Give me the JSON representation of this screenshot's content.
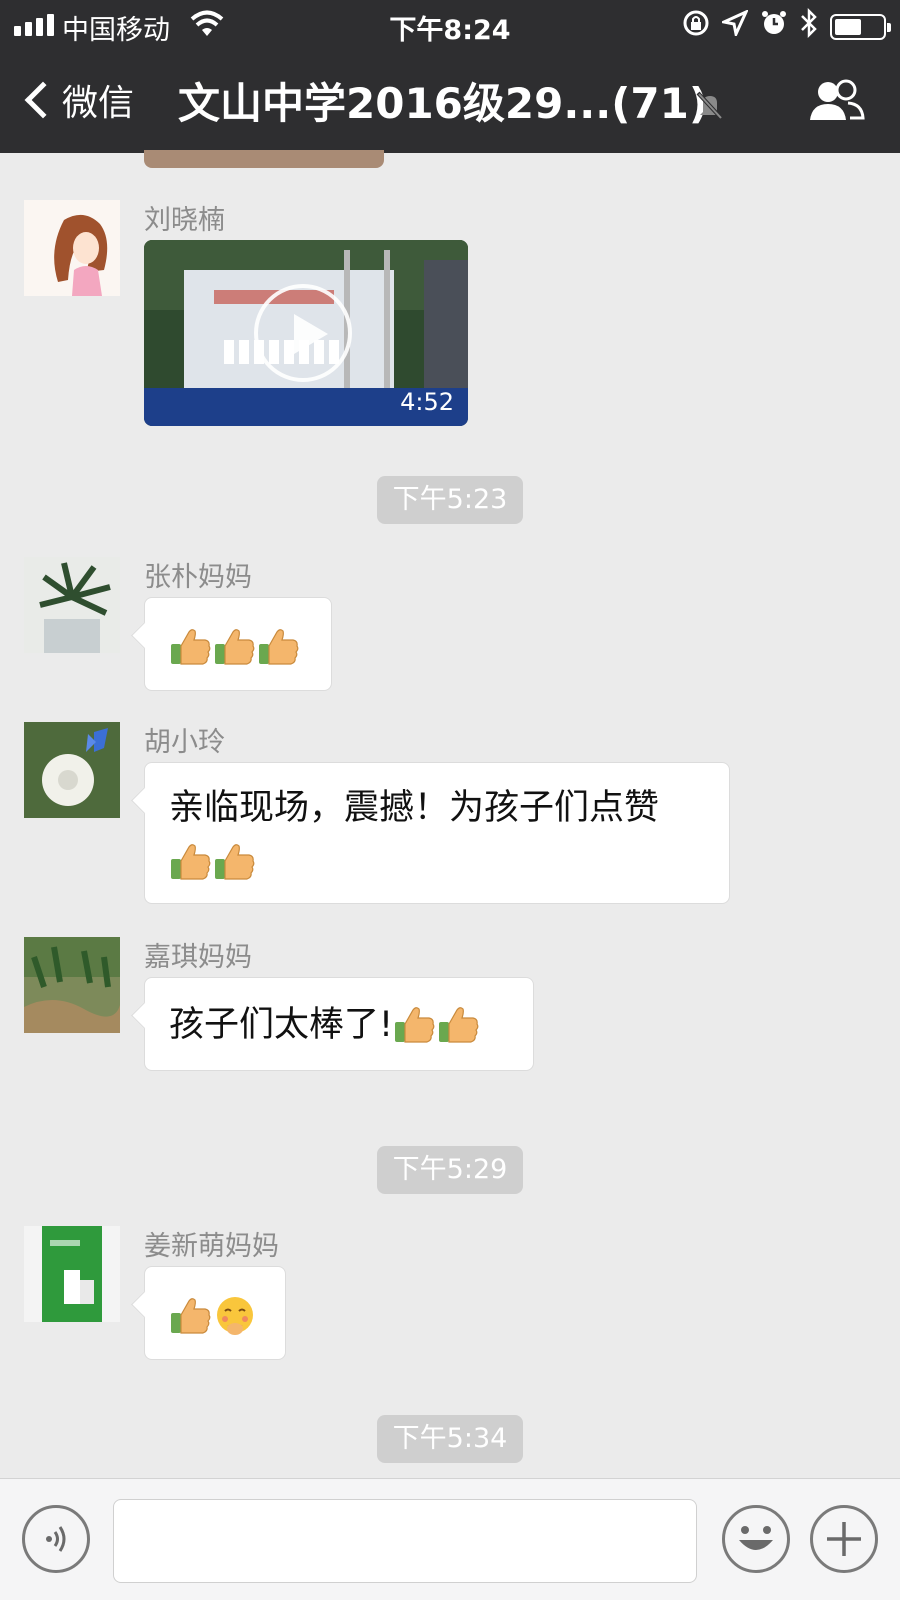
{
  "status_bar": {
    "carrier": "中国移动",
    "time": "下午8:24"
  },
  "nav": {
    "back_label": "微信",
    "title": "文山中学2016级29...(71)"
  },
  "timestamps": [
    "下午5:23",
    "下午5:29",
    "下午5:34"
  ],
  "messages": [
    {
      "sender": "刘晓楠",
      "type": "video",
      "duration": "4:52"
    },
    {
      "sender": "张朴妈妈",
      "type": "emoji",
      "content": "[thumbs-up x3]"
    },
    {
      "sender": "胡小玲",
      "line1": "亲临现场，震撼！为孩子们点赞",
      "type": "text+emoji"
    },
    {
      "sender": "嘉琪妈妈",
      "text": "孩子们太棒了!",
      "type": "text+emoji"
    },
    {
      "sender": "姜新萌妈妈",
      "type": "emoji"
    }
  ],
  "colors": {
    "header_bg": "#2e2e30",
    "chat_bg": "#ebebeb",
    "bubble_bg": "#ffffff",
    "timestamp_bg": "#cfcfcf"
  }
}
